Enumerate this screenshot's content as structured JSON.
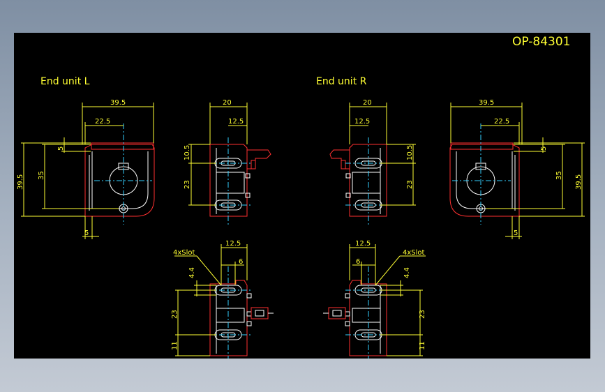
{
  "drawing": {
    "number": "OP-84301",
    "labels": {
      "left_unit": "End unit L",
      "right_unit": "End unit R",
      "slot_note": "4xSlot"
    },
    "colors": {
      "background": "#000000",
      "annotation": "#ffff33",
      "outline": "#ff3030",
      "body": "#ffffff",
      "center": "#34d0ff"
    },
    "dimensions": {
      "d39_5": "39.5",
      "d22_5": "22.5",
      "d35": "35",
      "d5": "5",
      "d20": "20",
      "d12_5": "12.5",
      "d10_5": "10.5",
      "d23": "23",
      "d6": "6",
      "d4_4": "4.4",
      "d11": "11"
    }
  }
}
